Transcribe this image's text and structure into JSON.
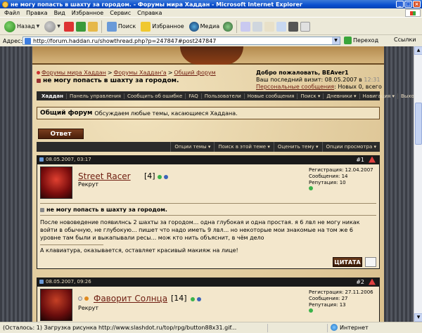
{
  "window": {
    "title": "не могу попасть в шахту за городом. - Форумы мира Хаддан - Microsoft Internet Explorer"
  },
  "menubar": [
    "Файл",
    "Правка",
    "Вид",
    "Избранное",
    "Сервис",
    "Справка"
  ],
  "toolbar": {
    "back": "Назад",
    "search": "Поиск",
    "favorites": "Избранное",
    "media": "Медиа"
  },
  "address": {
    "label": "Адрес:",
    "url": "http://forum.haddan.ru/showthread.php?p=247847#post247847",
    "go": "Переход",
    "links": "Ссылки"
  },
  "breadcrumb": {
    "items": [
      "Форумы мира Хаддан",
      "Форумы Хаддан'а",
      "Общий форум"
    ],
    "current": "не могу попасть в шахту за городом."
  },
  "userbox": {
    "welcome": "Добро пожаловать, BEAver1",
    "last_visit_label": "Ваш последний визит: 08.05.2007 в",
    "last_visit_time": "12:31",
    "pm_link": "Персональные сообщения",
    "pm_info": ": Новых 0, всего 1."
  },
  "navstrip": [
    "Хаддан",
    "Панель управления",
    "Сообщить об ошибке",
    "FAQ",
    "Пользователи",
    "Новые сообщения",
    "Поиск ▾",
    "Дневники ▾",
    "Навигация ▾",
    "Выход"
  ],
  "forum": {
    "name": "Общий форум",
    "description": "Обсуждаем любые темы, касающиеся Хаддана."
  },
  "reply_button": "Ответ",
  "threadtools": [
    "Опции темы ▾",
    "Поиск в этой теме ▾",
    "Оценить тему ▾",
    "Опции просмотра ▾"
  ],
  "posts": [
    {
      "date": "08.05.2007, 03:17",
      "number": "#1",
      "username": "Street Racer",
      "level": "[4]",
      "rank": "Рекрут",
      "reg": "Регистрация: 12.04.2007",
      "msgs": "Сообщения: 14",
      "reputation": "Репутация: 10",
      "title": "не могу попасть в шахту за городом.",
      "text": "После нововедение появилнсь 2 шахты за городом... одна глубокая и одна простая. я 6 лвл не могу никак войти в обычную, не глубокую... пишет что надо иметь 9 лвл... но некоторые мои знакомые на том же 6 уровне там были и выкапывали ресы... мож кто нить объяснит, в чём дело",
      "signature": "А клавиатура, оказывается, оставляет красивый макияж на лице!",
      "quote": "ЦИТАТА"
    },
    {
      "date": "08.05.2007, 09:26",
      "number": "#2",
      "username": "Фаворит Солнца",
      "level": "[14]",
      "rank": "Рекрут",
      "reg": "Регистрация: 27.11.2006",
      "msgs": "Сообщения: 27",
      "reputation": "Репутация: 13"
    }
  ],
  "status": {
    "text": "(Осталось: 1) Загрузка рисунка http://www.slashdot.ru/top/rpg/button88x31.gif...",
    "zone": "Интернет"
  },
  "colors": {
    "link": "#6e1c0f",
    "parchment": "#e7d3a8",
    "dark_strip": "#2a2a2a"
  }
}
